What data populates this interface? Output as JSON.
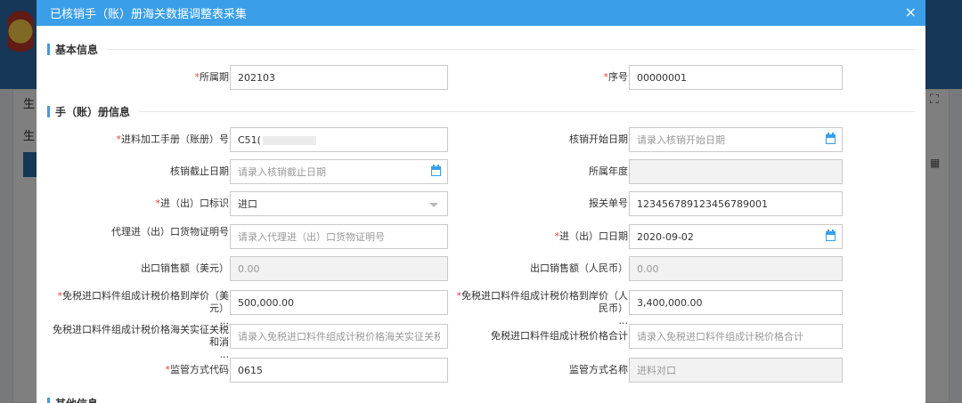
{
  "modal": {
    "title": "已核销手（账）册海关数据调整表采集",
    "close_glyph": "×"
  },
  "background": {
    "left_label_1": "生",
    "left_label_2": "生",
    "expand_glyph": "⛶",
    "columns_glyph": "▦"
  },
  "sections": {
    "basic": "基本信息",
    "handbook": "手（账）册信息",
    "other": "其他信息"
  },
  "fields": {
    "period": {
      "label": "所属期",
      "value": "202103",
      "required": true
    },
    "seq": {
      "label": "序号",
      "value": "00000001",
      "required": true
    },
    "handbook_no": {
      "label": "进料加工手册（账册）号",
      "value": "C51(",
      "required": true
    },
    "verify_start": {
      "label": "核销开始日期",
      "placeholder": "请录入核销开始日期"
    },
    "verify_end": {
      "label": "核销截止日期",
      "placeholder": "请录入核销截止日期"
    },
    "year": {
      "label": "所属年度",
      "value": ""
    },
    "io_flag": {
      "label": "进（出）口标识",
      "value": "进口",
      "required": true
    },
    "declaration_no": {
      "label": "报关单号",
      "value": "123456789123456789001"
    },
    "agent_cert": {
      "label": "代理进（出）口货物证明号",
      "placeholder": "请录入代理进（出）口货物证明号"
    },
    "io_date": {
      "label": "进（出）口日期",
      "value": "2020-09-02",
      "required": true
    },
    "export_usd": {
      "label": "出口销售额（美元）",
      "value": "0.00"
    },
    "export_rmb": {
      "label": "出口销售额（人民币）",
      "value": "0.00"
    },
    "cif_usd": {
      "label": "免税进口料件组成计税价格到岸价（美元）",
      "label_suffix": "...",
      "value": "500,000.00",
      "required": true
    },
    "cif_rmb": {
      "label": "免税进口料件组成计税价格到岸价（人民币）",
      "label_suffix": "...",
      "value": "3,400,000.00",
      "required": true
    },
    "customs_tax": {
      "label": "免税进口料件组成计税价格海关实征关税和消",
      "label_suffix": "...",
      "placeholder": "请录入免税进口料件组成计税价格海关实征关税和消费税"
    },
    "tax_total": {
      "label": "免税进口料件组成计税价格合计",
      "placeholder": "请录入免税进口料件组成计税价格合计"
    },
    "supervision_code": {
      "label": "监管方式代码",
      "value": "0615",
      "required": true
    },
    "supervision_name": {
      "label": "监管方式名称",
      "value": "进料对口"
    }
  }
}
